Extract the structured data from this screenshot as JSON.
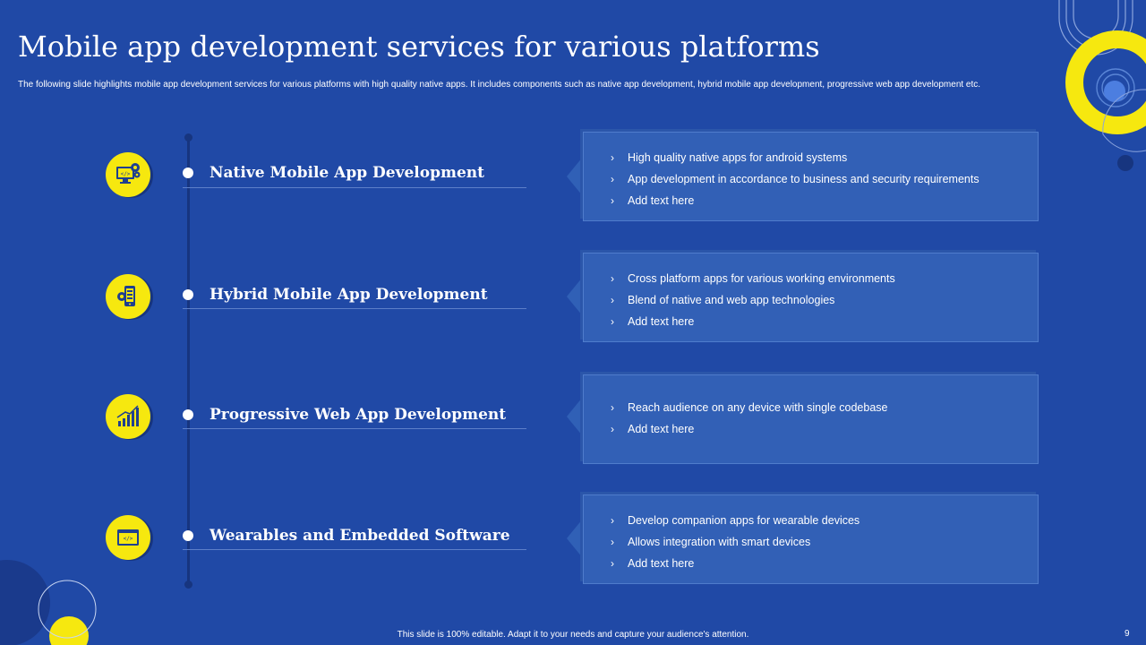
{
  "slide": {
    "title": "Mobile app development services for various platforms",
    "subtitle": "The following slide highlights mobile  app development services for various platforms with high quality native apps. It includes components such as native app development, hybrid mobile  app development, progressive web app development etc."
  },
  "services": [
    {
      "title": "Native Mobile App Development",
      "icon": "computer-gear-icon",
      "bullets": [
        "High quality native apps for android systems",
        "App development  in accordance to business and security requirements",
        "Add text here"
      ]
    },
    {
      "title": "Hybrid Mobile App Development",
      "icon": "mobile-gear-icon",
      "bullets": [
        "Cross platform apps for various working environments",
        "Blend of native and web app technologies",
        "Add text here"
      ]
    },
    {
      "title": "Progressive Web App Development",
      "icon": "growth-bars-icon",
      "bullets": [
        "Reach audience on any device with single codebase",
        "Add text here"
      ]
    },
    {
      "title": "Wearables and Embedded Software",
      "icon": "code-window-icon",
      "bullets": [
        "Develop companion apps for wearable  devices",
        "Allows integration with smart devices",
        "Add text here"
      ]
    }
  ],
  "bullet_glyph": "›",
  "footer": {
    "text": "This slide is 100% editable.  Adapt it to your needs and capture your audience's attention.",
    "page_number": "9"
  },
  "colors": {
    "background": "#2049a6",
    "accent_yellow": "#f6e80f",
    "card": "#3260b6",
    "timeline": "#17357f"
  }
}
